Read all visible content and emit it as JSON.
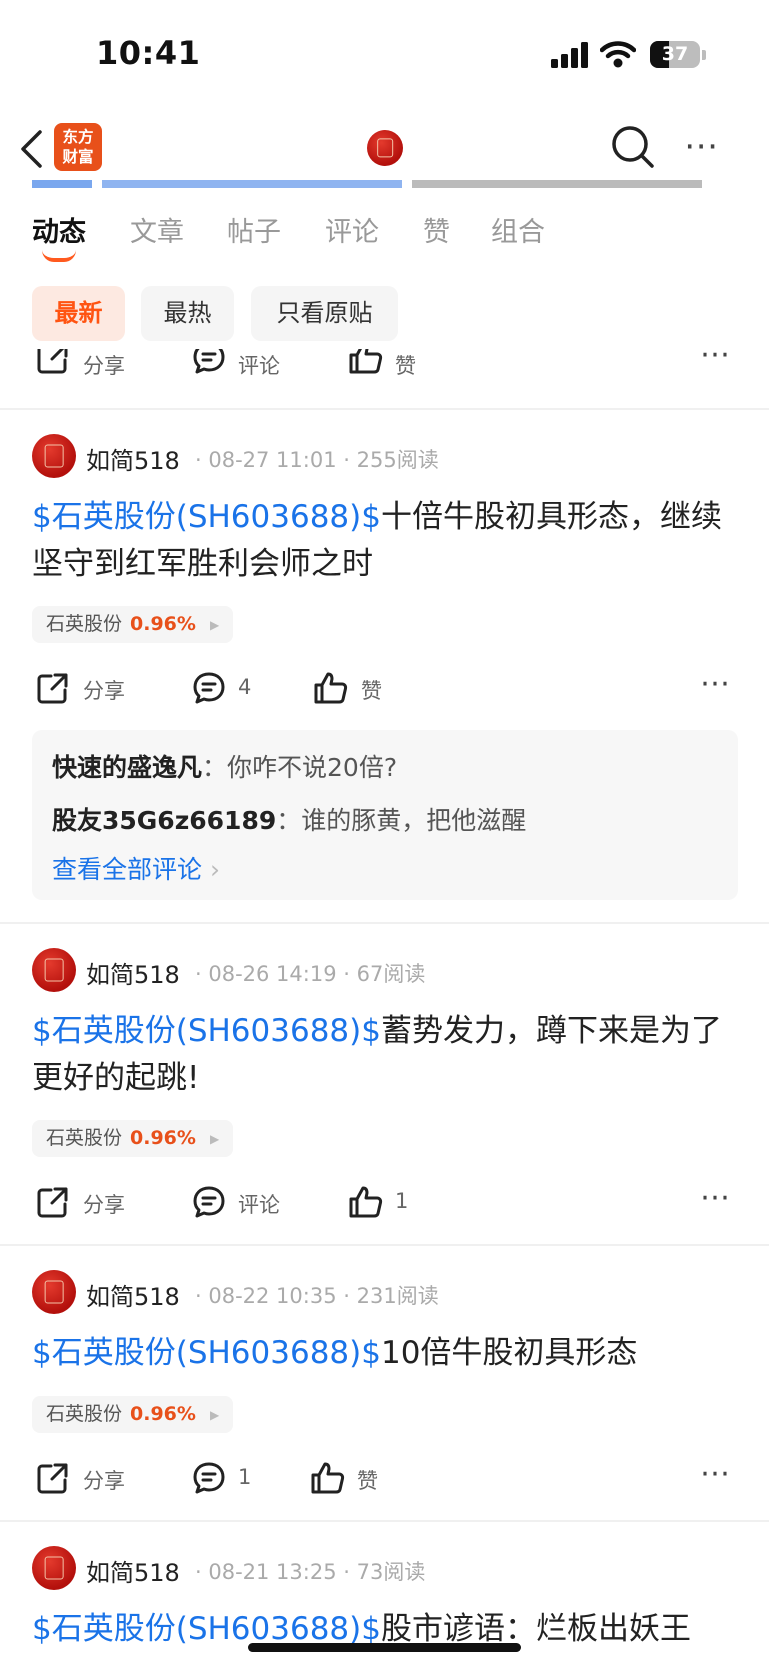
{
  "status_bar": {
    "time": "10:41",
    "battery": "37",
    "battery_level_percent": 37
  },
  "nav": {
    "brand_line1": "东方",
    "brand_line2": "财富",
    "icons": [
      "back-arrow-icon",
      "search-icon",
      "more-icon"
    ]
  },
  "tabs": [
    {
      "label": "动态",
      "active": true
    },
    {
      "label": "文章"
    },
    {
      "label": "帖子"
    },
    {
      "label": "评论"
    },
    {
      "label": "赞"
    },
    {
      "label": "组合"
    }
  ],
  "filters": [
    {
      "label": "最新",
      "active": true
    },
    {
      "label": "最热"
    },
    {
      "label": "只看原贴"
    }
  ],
  "top_actions": {
    "share": "分享",
    "comment": "评论",
    "like": "赞"
  },
  "posts": [
    {
      "author": "如简518",
      "date": "08-27 11:01",
      "reads": "255阅读",
      "stock_link": "$石英股份(SH603688)$",
      "text": "十倍牛股初具形态，继续坚守到红军胜利会师之时",
      "chip_name": "石英股份",
      "chip_pct": "0.96%",
      "share": "分享",
      "comment": "4",
      "like": "赞",
      "comments": [
        {
          "user": "快速的盛逸凡",
          "sep": "：",
          "text": "你咋不说20倍?"
        },
        {
          "user": "股友35G6z66189",
          "sep": "：",
          "text": "谁的豚黄，把他滋醒"
        }
      ],
      "view_all": "查看全部评论"
    },
    {
      "author": "如简518",
      "date": "08-26 14:19",
      "reads": "67阅读",
      "stock_link": "$石英股份(SH603688)$",
      "text": "蓄势发力，蹲下来是为了更好的起跳!",
      "chip_name": "石英股份",
      "chip_pct": "0.96%",
      "share": "分享",
      "comment": "评论",
      "like": "1"
    },
    {
      "author": "如简518",
      "date": "08-22 10:35",
      "reads": "231阅读",
      "stock_link": "$石英股份(SH603688)$",
      "text": "10倍牛股初具形态",
      "chip_name": "石英股份",
      "chip_pct": "0.96%",
      "share": "分享",
      "comment": "1",
      "like": "赞"
    },
    {
      "author": "如简518",
      "date": "08-21 13:25",
      "reads": "73阅读",
      "stock_link": "$石英股份(SH603688)$",
      "text": "股市谚语：烂板出妖王"
    }
  ],
  "colors": {
    "accent": "#ff5a1f",
    "link": "#1a73e8",
    "price_up": "#e8501a"
  }
}
